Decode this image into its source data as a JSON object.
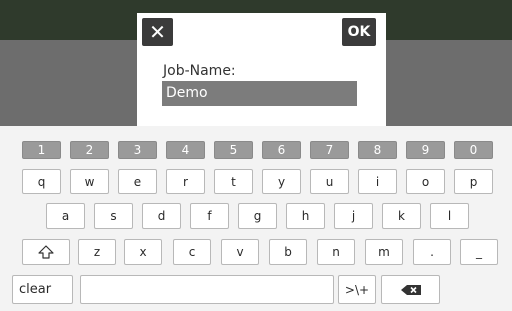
{
  "dialog": {
    "close_label": "✕",
    "ok_label": "OK",
    "field_label": "Job-Name:",
    "field_value": "Demo"
  },
  "keyboard": {
    "row_numbers": [
      "1",
      "2",
      "3",
      "4",
      "5",
      "6",
      "7",
      "8",
      "9",
      "0"
    ],
    "row1": [
      "q",
      "w",
      "e",
      "r",
      "t",
      "y",
      "u",
      "i",
      "o",
      "p"
    ],
    "row2": [
      "a",
      "s",
      "d",
      "f",
      "g",
      "h",
      "j",
      "k",
      "l"
    ],
    "row3": [
      "z",
      "x",
      "c",
      "v",
      "b",
      "n",
      "m",
      ".",
      "_"
    ],
    "shift_icon": "shift-arrow-icon",
    "clear_label": "clear",
    "symbols_label": ">\\+",
    "backspace_icon": "backspace-icon"
  },
  "colors": {
    "top_bar": "#2f3a2c",
    "overlay": "#6d6d6d",
    "button_dark": "#3b3b3b",
    "input_bg": "#7c7c7c",
    "number_key": "#9a9a9a",
    "keyboard_bg": "#f3f3f3"
  }
}
